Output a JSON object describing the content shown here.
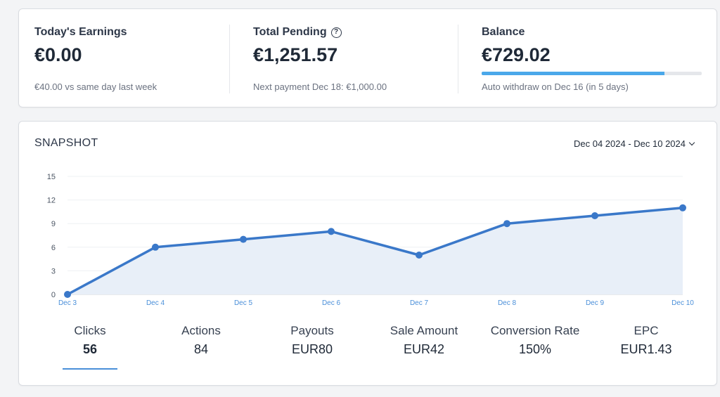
{
  "summary": {
    "todays_earnings": {
      "label": "Today's Earnings",
      "value": "€0.00",
      "sub": "€40.00 vs same day last week"
    },
    "total_pending": {
      "label": "Total Pending",
      "help_icon": "question-circle-icon",
      "help_glyph": "?",
      "value": "€1,251.57",
      "sub": "Next payment Dec 18: €1,000.00"
    },
    "balance": {
      "label": "Balance",
      "value": "€729.02",
      "progress_percent": 83,
      "sub": "Auto withdraw on Dec 16 (in 5 days)"
    }
  },
  "snapshot": {
    "title": "SNAPSHOT",
    "date_range": "Dec 04 2024 - Dec 10 2024",
    "metrics": [
      {
        "label": "Clicks",
        "value": "56",
        "active": true
      },
      {
        "label": "Actions",
        "value": "84",
        "active": false
      },
      {
        "label": "Payouts",
        "value": "EUR80",
        "active": false
      },
      {
        "label": "Sale Amount",
        "value": "EUR42",
        "active": false
      },
      {
        "label": "Conversion Rate",
        "value": "150%",
        "active": false
      },
      {
        "label": "EPC",
        "value": "EUR1.43",
        "active": false
      }
    ]
  },
  "colors": {
    "line": "#3a78c9",
    "area": "#e8eff8",
    "accent": "#4aa8ea",
    "underline": "#4a8fd9",
    "x_tick": "#4a8fd9"
  },
  "chart_data": {
    "type": "area",
    "x": [
      "Dec 3",
      "Dec 4",
      "Dec 5",
      "Dec 6",
      "Dec 7",
      "Dec 8",
      "Dec 9",
      "Dec 10"
    ],
    "series": [
      {
        "values": [
          0,
          6,
          7,
          8,
          5,
          9,
          10,
          11
        ]
      }
    ],
    "yticks": [
      0,
      3,
      6,
      9,
      12,
      15
    ],
    "ylim": [
      0,
      15
    ],
    "grid": true,
    "title": "",
    "xlabel": "",
    "ylabel": ""
  }
}
